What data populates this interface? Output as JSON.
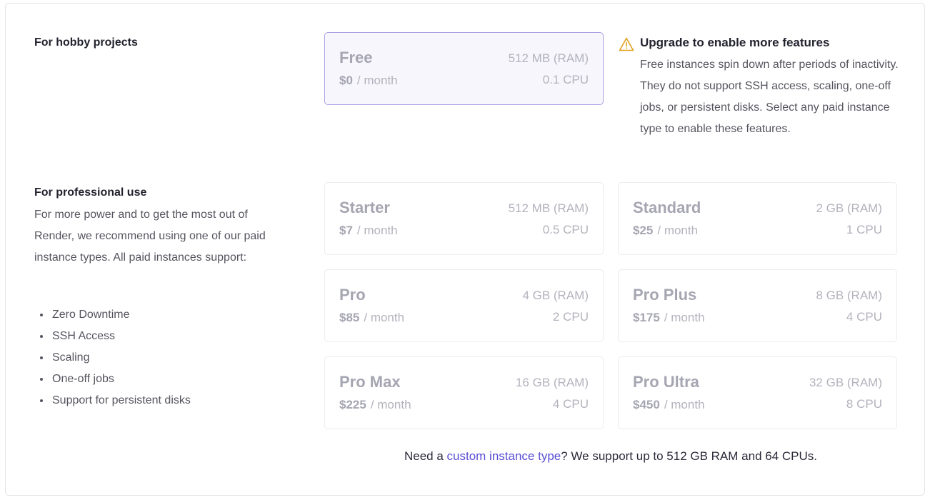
{
  "hobby": {
    "title": "For hobby projects"
  },
  "professional": {
    "title": "For professional use",
    "description": "For more power and to get the most out of Render, we recommend using one of our paid instance types. All paid instances support:",
    "features": [
      "Zero Downtime",
      "SSH Access",
      "Scaling",
      "One-off jobs",
      "Support for persistent disks"
    ]
  },
  "period": "/ month",
  "instances": {
    "free": {
      "name": "Free",
      "price": "$0",
      "ram": "512 MB (RAM)",
      "cpu": "0.1 CPU",
      "selected": true
    },
    "starter": {
      "name": "Starter",
      "price": "$7",
      "ram": "512 MB (RAM)",
      "cpu": "0.5 CPU"
    },
    "standard": {
      "name": "Standard",
      "price": "$25",
      "ram": "2 GB (RAM)",
      "cpu": "1 CPU"
    },
    "pro": {
      "name": "Pro",
      "price": "$85",
      "ram": "4 GB (RAM)",
      "cpu": "2 CPU"
    },
    "pro_plus": {
      "name": "Pro Plus",
      "price": "$175",
      "ram": "8 GB (RAM)",
      "cpu": "4 CPU"
    },
    "pro_max": {
      "name": "Pro Max",
      "price": "$225",
      "ram": "16 GB (RAM)",
      "cpu": "4 CPU"
    },
    "pro_ultra": {
      "name": "Pro Ultra",
      "price": "$450",
      "ram": "32 GB (RAM)",
      "cpu": "8 CPU"
    }
  },
  "warning": {
    "icon": "warning-triangle-icon",
    "color": "#e0a21c",
    "title": "Upgrade to enable more features",
    "body": "Free instances spin down after periods of inactivity. They do not support SSH access, scaling, one-off jobs, or persistent disks. Select any paid instance type to enable these features."
  },
  "footer": {
    "prefix": "Need a ",
    "link": "custom instance type",
    "suffix": "? We support up to 512 GB RAM and 64 CPUs."
  }
}
